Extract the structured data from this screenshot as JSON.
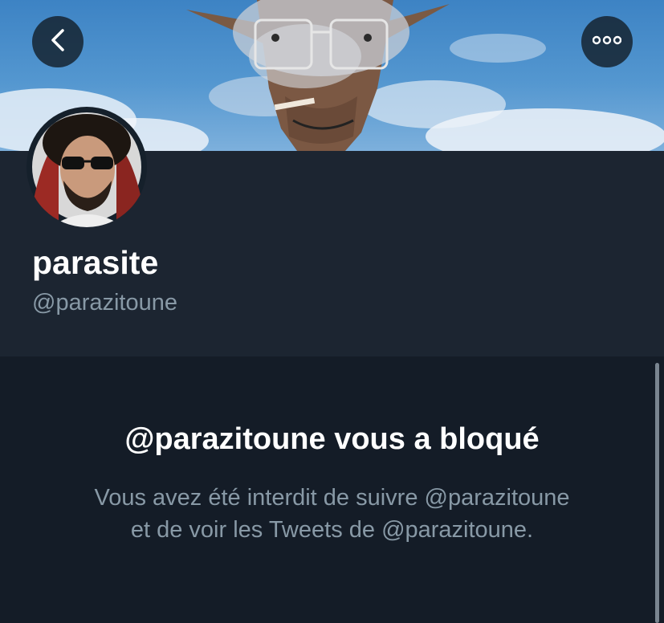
{
  "profile": {
    "display_name": "parasite",
    "handle": "@parazitoune"
  },
  "blocked_notice": {
    "title": "@parazitoune vous a bloqué",
    "line1": "Vous avez été interdit de suivre @parazitoune",
    "line2": "et de voir les Tweets de @parazitoune."
  },
  "icons": {
    "back": "chevron-left-icon",
    "more": "more-options-icon"
  },
  "colors": {
    "background": "#15202b",
    "header_background": "#1c2531",
    "panel_background": "#141c27",
    "primary_text": "#ffffff",
    "secondary_text": "#8899a6"
  }
}
